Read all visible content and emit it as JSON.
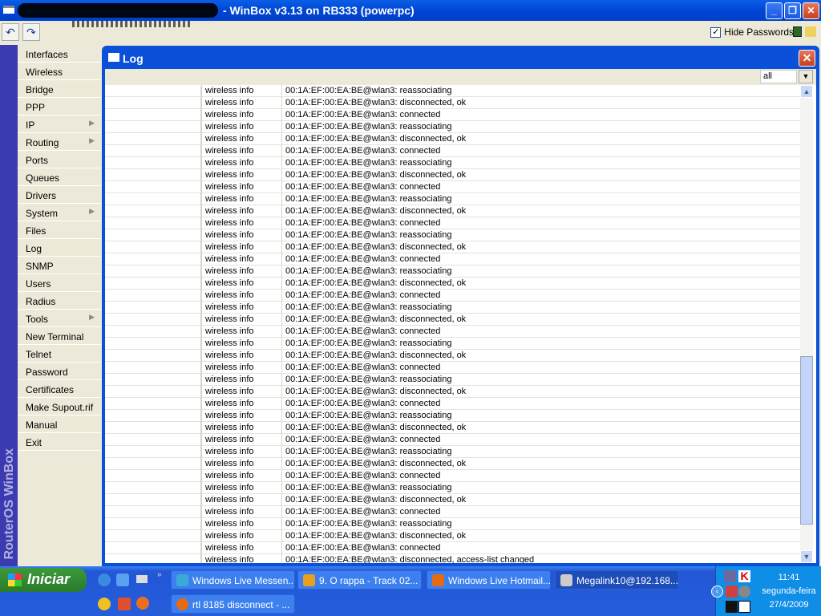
{
  "window": {
    "title": "- WinBox v3.13 on RB333 (powerpc)"
  },
  "toolbar": {
    "undo_icon": "undo-icon",
    "redo_icon": "redo-icon",
    "hide_passwords_label": "Hide Passwords",
    "hide_passwords_checked": true
  },
  "sidebar": {
    "brand": "RouterOS WinBox",
    "items": [
      {
        "label": "Interfaces"
      },
      {
        "label": "Wireless"
      },
      {
        "label": "Bridge"
      },
      {
        "label": "PPP"
      },
      {
        "label": "IP",
        "submenu": true
      },
      {
        "label": "Routing",
        "submenu": true
      },
      {
        "label": "Ports"
      },
      {
        "label": "Queues"
      },
      {
        "label": "Drivers"
      },
      {
        "label": "System",
        "submenu": true
      },
      {
        "label": "Files"
      },
      {
        "label": "Log"
      },
      {
        "label": "SNMP"
      },
      {
        "label": "Users"
      },
      {
        "label": "Radius"
      },
      {
        "label": "Tools",
        "submenu": true
      },
      {
        "label": "New Terminal"
      },
      {
        "label": "Telnet"
      },
      {
        "label": "Password"
      },
      {
        "label": "Certificates"
      },
      {
        "label": "Make Supout.rif"
      },
      {
        "label": "Manual"
      },
      {
        "label": "Exit"
      }
    ]
  },
  "log": {
    "title": "Log",
    "filter_value": "all",
    "rows": [
      [
        "",
        "wireless info",
        "00:1A:EF:00:EA:BE@wlan3: reassociating"
      ],
      [
        "",
        "wireless info",
        "00:1A:EF:00:EA:BE@wlan3: disconnected, ok"
      ],
      [
        "",
        "wireless info",
        "00:1A:EF:00:EA:BE@wlan3: connected"
      ],
      [
        "",
        "wireless info",
        "00:1A:EF:00:EA:BE@wlan3: reassociating"
      ],
      [
        "",
        "wireless info",
        "00:1A:EF:00:EA:BE@wlan3: disconnected, ok"
      ],
      [
        "",
        "wireless info",
        "00:1A:EF:00:EA:BE@wlan3: connected"
      ],
      [
        "",
        "wireless info",
        "00:1A:EF:00:EA:BE@wlan3: reassociating"
      ],
      [
        "",
        "wireless info",
        "00:1A:EF:00:EA:BE@wlan3: disconnected, ok"
      ],
      [
        "",
        "wireless info",
        "00:1A:EF:00:EA:BE@wlan3: connected"
      ],
      [
        "",
        "wireless info",
        "00:1A:EF:00:EA:BE@wlan3: reassociating"
      ],
      [
        "",
        "wireless info",
        "00:1A:EF:00:EA:BE@wlan3: disconnected, ok"
      ],
      [
        "",
        "wireless info",
        "00:1A:EF:00:EA:BE@wlan3: connected"
      ],
      [
        "",
        "wireless info",
        "00:1A:EF:00:EA:BE@wlan3: reassociating"
      ],
      [
        "",
        "wireless info",
        "00:1A:EF:00:EA:BE@wlan3: disconnected, ok"
      ],
      [
        "",
        "wireless info",
        "00:1A:EF:00:EA:BE@wlan3: connected"
      ],
      [
        "",
        "wireless info",
        "00:1A:EF:00:EA:BE@wlan3: reassociating"
      ],
      [
        "",
        "wireless info",
        "00:1A:EF:00:EA:BE@wlan3: disconnected, ok"
      ],
      [
        "",
        "wireless info",
        "00:1A:EF:00:EA:BE@wlan3: connected"
      ],
      [
        "",
        "wireless info",
        "00:1A:EF:00:EA:BE@wlan3: reassociating"
      ],
      [
        "",
        "wireless info",
        "00:1A:EF:00:EA:BE@wlan3: disconnected, ok"
      ],
      [
        "",
        "wireless info",
        "00:1A:EF:00:EA:BE@wlan3: connected"
      ],
      [
        "",
        "wireless info",
        "00:1A:EF:00:EA:BE@wlan3: reassociating"
      ],
      [
        "",
        "wireless info",
        "00:1A:EF:00:EA:BE@wlan3: disconnected, ok"
      ],
      [
        "",
        "wireless info",
        "00:1A:EF:00:EA:BE@wlan3: connected"
      ],
      [
        "",
        "wireless info",
        "00:1A:EF:00:EA:BE@wlan3: reassociating"
      ],
      [
        "",
        "wireless info",
        "00:1A:EF:00:EA:BE@wlan3: disconnected, ok"
      ],
      [
        "",
        "wireless info",
        "00:1A:EF:00:EA:BE@wlan3: connected"
      ],
      [
        "",
        "wireless info",
        "00:1A:EF:00:EA:BE@wlan3: reassociating"
      ],
      [
        "",
        "wireless info",
        "00:1A:EF:00:EA:BE@wlan3: disconnected, ok"
      ],
      [
        "",
        "wireless info",
        "00:1A:EF:00:EA:BE@wlan3: connected"
      ],
      [
        "",
        "wireless info",
        "00:1A:EF:00:EA:BE@wlan3: reassociating"
      ],
      [
        "",
        "wireless info",
        "00:1A:EF:00:EA:BE@wlan3: disconnected, ok"
      ],
      [
        "",
        "wireless info",
        "00:1A:EF:00:EA:BE@wlan3: connected"
      ],
      [
        "",
        "wireless info",
        "00:1A:EF:00:EA:BE@wlan3: reassociating"
      ],
      [
        "",
        "wireless info",
        "00:1A:EF:00:EA:BE@wlan3: disconnected, ok"
      ],
      [
        "",
        "wireless info",
        "00:1A:EF:00:EA:BE@wlan3: connected"
      ],
      [
        "",
        "wireless info",
        "00:1A:EF:00:EA:BE@wlan3: reassociating"
      ],
      [
        "",
        "wireless info",
        "00:1A:EF:00:EA:BE@wlan3: disconnected, ok"
      ],
      [
        "",
        "wireless info",
        "00:1A:EF:00:EA:BE@wlan3: connected"
      ],
      [
        "",
        "wireless info",
        "00:1A:EF:00:EA:BE@wlan3: disconnected, access-list changed"
      ]
    ]
  },
  "taskbar": {
    "start_label": "Iniciar",
    "tasks_row1": [
      {
        "label": "Windows Live Messen...",
        "color": "#3aa8d8"
      },
      {
        "label": "9. O rappa - Track 02...",
        "color": "#e8a020"
      },
      {
        "label": "Windows Live Hotmail...",
        "color": "#e86a10"
      },
      {
        "label": "Megalink10@192.168...",
        "color": "#cccccc",
        "active": true
      }
    ],
    "tasks_row2": [
      {
        "label": "rtl 8185 disconnect - ...",
        "color": "#e86a10"
      }
    ],
    "clock": {
      "time": "11:41",
      "day": "segunda-feira",
      "date": "27/4/2009"
    }
  }
}
